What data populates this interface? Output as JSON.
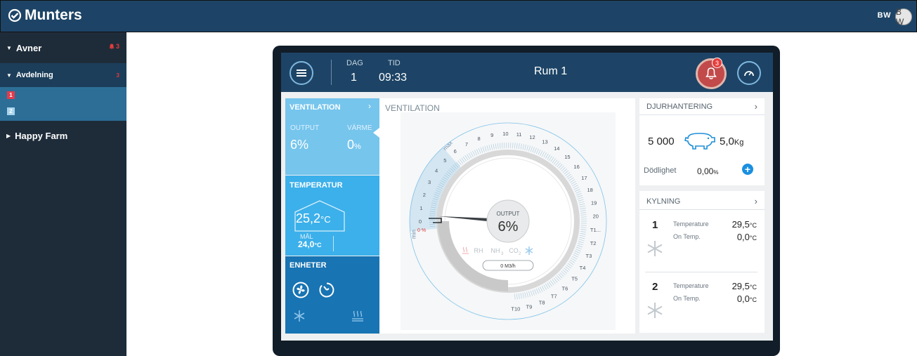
{
  "app": {
    "brand": "Munters",
    "user_initials": "BW",
    "avatar_initials": "B W"
  },
  "sidebar": {
    "avner": {
      "label": "Avner",
      "alert_count": "3"
    },
    "avdelning": {
      "label": "Avdelning",
      "alert_count": "3"
    },
    "rooms": [
      "1",
      "2"
    ],
    "happy_farm": {
      "label": "Happy Farm"
    }
  },
  "header": {
    "dag_label": "DAG",
    "dag_value": "1",
    "tid_label": "TID",
    "tid_value": "09:33",
    "room_title": "Rum 1",
    "alarm_count": "3"
  },
  "ventilation_card": {
    "title": "VENTILATION",
    "output_label": "OUTPUT",
    "output_value": "6%",
    "heat_label": "VÄRME",
    "heat_value": "0",
    "heat_unit": "%"
  },
  "temperature_card": {
    "title": "TEMPERATUR",
    "value": "25,2",
    "unit": "°C",
    "target_label": "MÅL",
    "target_value": "24,0",
    "target_unit": "°C"
  },
  "devices_card": {
    "title": "ENHETER"
  },
  "gauge": {
    "title": "VENTILATION",
    "output_label": "OUTPUT",
    "output_value": "6%",
    "output_fraction": 0.06,
    "airflow": "0 M3/h",
    "min_label": "min",
    "max_label": "max",
    "zero_label": "0",
    "zero_pct": "0 %",
    "levels": [
      "0",
      "1",
      "2",
      "3",
      "4",
      "5",
      "6",
      "7",
      "8",
      "9",
      "10",
      "11",
      "12",
      "13",
      "14",
      "15",
      "16",
      "17",
      "18",
      "19",
      "20",
      "T1...",
      "T2",
      "T3",
      "T4",
      "T5",
      "T6",
      "T7",
      "T8",
      "T9",
      "T10"
    ],
    "sensor_labels": {
      "rh": "RH",
      "nh3": "NH",
      "nh3_sub": "3",
      "co2": "CO",
      "co2_sub": "2"
    },
    "colors": {
      "ring": "#d8d8d8",
      "active": "#5aaedc",
      "needle": "#3a3f44"
    }
  },
  "animal_card": {
    "title": "DJURHANTERING",
    "count": "5 000",
    "weight": "5,0",
    "weight_unit": "Kg",
    "mortality_label": "Dödlighet",
    "mortality_value": "0,00",
    "mortality_unit": "%"
  },
  "cooling_card": {
    "title": "KYLNING",
    "units": [
      {
        "num": "1",
        "temp_label": "Temperature",
        "temp_value": "29,5",
        "temp_unit": "°C",
        "on_label": "On Temp.",
        "on_value": "0,0",
        "on_unit": "°C"
      },
      {
        "num": "2",
        "temp_label": "Temperature",
        "temp_value": "29,5",
        "temp_unit": "°C",
        "on_label": "On Temp.",
        "on_value": "0,0",
        "on_unit": "°C"
      }
    ]
  },
  "colors": {
    "topbar": "#1d4466",
    "sidebar": "#1e2c3a",
    "vent_card": "#76c5ed",
    "temp_card": "#3cb0ea",
    "devices_card": "#1874b3",
    "alarm": "#e23b3b"
  },
  "icons": {
    "brand": "munters-logo-icon",
    "menu": "menu-icon",
    "bell": "bell-icon",
    "gauge": "speedometer-icon",
    "fan": "fan-icon",
    "timer": "timer-icon",
    "snowflake": "snowflake-icon",
    "heater": "heater-icon",
    "pig": "pig-icon",
    "plus": "plus-icon"
  }
}
